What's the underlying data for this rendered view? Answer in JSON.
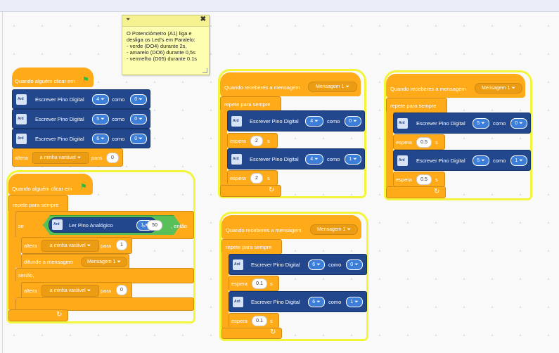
{
  "note": {
    "text": "O Potenciómetro (A1) liga e desliga os Led's em Paralelo:\n- verde (DO4) durante 2s,\n- amarelo (DO6) durante 0,5s\n- vermelho (D05) durante 0.1s",
    "collapse_glyph": "⏷",
    "close_glyph": "✖"
  },
  "common": {
    "arduino_icon_label": "Ard",
    "write_digital": "Escrever Pino Digital",
    "as": "como",
    "wait": "espera",
    "seconds": "s",
    "when_clicked": "Quando alguém clicar em",
    "forever": "repete para sempre",
    "when_receive": "Quando receberes a mensagem",
    "message": "Mensagem 1 ⏷",
    "set": "altera",
    "to": "para",
    "my_variable": "a minha variável ⏷",
    "flag": "⚑",
    "loop_arrow": "↻"
  },
  "stack1": {
    "rows": [
      {
        "pin": "4 ⏷",
        "value": "0 ⏷"
      },
      {
        "pin": "5 ⏷",
        "value": "0 ⏷"
      },
      {
        "pin": "6 ⏷",
        "value": "0 ⏷"
      }
    ],
    "set_value": "0"
  },
  "stack2": {
    "if_label": "se",
    "analog_read": "Ler Pino Analógico",
    "analog_pin": "1 ⏷",
    "operator": ">",
    "threshold": "50",
    "then": ", então",
    "set_value_1": "1",
    "broadcast": "difunde a mensagem",
    "broadcast_msg": "Mensagem 1 ⏷",
    "else": "senão,",
    "set_value_2": "0"
  },
  "stack3": {
    "pin": "4 ⏷",
    "v1": "0 ⏷",
    "wait1": "2",
    "v2": "1 ⏷",
    "wait2": "2"
  },
  "stack4": {
    "pin": "5 ⏷",
    "v1": "0 ⏷",
    "wait1": "0.5",
    "v2": "1 ⏷",
    "wait2": "0.5"
  },
  "stack5": {
    "pin": "6 ⏷",
    "v1": "0 ⏷",
    "wait1": "0.1",
    "v2": "1 ⏷",
    "wait2": "0.1"
  },
  "colors": {
    "event": "#ffab19",
    "arduino": "#22478c",
    "operator": "#59c059",
    "glow": "#f3f53a",
    "note": "#fefeb0"
  }
}
